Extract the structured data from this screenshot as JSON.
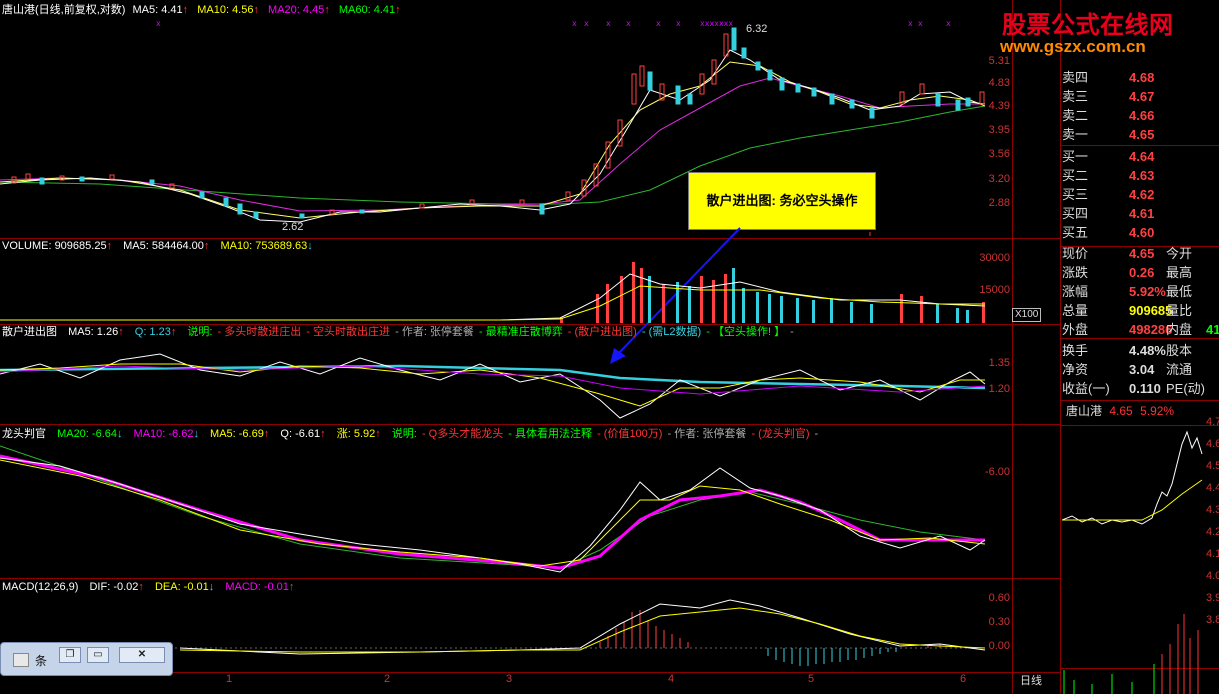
{
  "header": {
    "title": "唐山港(日线,前复权,对数)",
    "ma5": "MA5: 4.41",
    "ma10": "MA10: 4.56",
    "ma20": "MA20: 4.45",
    "ma60": "MA60: 4.41"
  },
  "main_axis": [
    "5.31",
    "4.83",
    "4.39",
    "3.95",
    "3.56",
    "3.20",
    "2.88"
  ],
  "price_notes": {
    "high": "6.32",
    "low": "2.62"
  },
  "volume": {
    "label": "VOLUME: 909685.25",
    "ma5": "MA5: 584464.00",
    "ma10": "MA10: 753689.63",
    "axis": [
      "30000",
      "15000"
    ],
    "unit": "X100"
  },
  "sanhu": {
    "name": "散户进出图",
    "ma5": "MA5: 1.26",
    "q": "Q: 1.23",
    "desc_label": "说明:",
    "d1": "- 多头时散进庄出",
    "d2": "- 空头时散出庄进",
    "d3": "- 作者: 张停套餐",
    "d4": "- 最精准庄散博弈",
    "d5": "- (散户进出图)",
    "d6": "- (需L2数据)",
    "d7": "- 【空头操作! 】",
    "d8": "-",
    "axis": [
      "1.35",
      "1.20"
    ]
  },
  "longtou": {
    "name": "龙头判官",
    "ma20": "MA20: -6.64",
    "ma10": "MA10: -6.62",
    "ma5": "MA5: -6.69",
    "q": "Q: -6.61",
    "zhang": "涨: 5.92",
    "desc_label": "说明:",
    "d1": "- Q多头才能龙头",
    "d2": "- 具体看用法注释",
    "d3": "- (价值100万)",
    "d4": "- 作者: 张停套餐",
    "d5": "- (龙头判官)",
    "d6": "-",
    "axis": [
      "-6.00"
    ]
  },
  "macd": {
    "label": "MACD(12,26,9)",
    "dif": "DIF: -0.02",
    "dea": "DEA: -0.01",
    "macd": "MACD: -0.01",
    "axis": [
      "0.60",
      "0.30",
      "0.00"
    ]
  },
  "x_axis": [
    "1",
    "2",
    "3",
    "4",
    "5",
    "6"
  ],
  "callout": "散户进出图: 务必空头操作",
  "watermark": {
    "line1": "股票公式在线网",
    "line2": "www.gszx.com.cn"
  },
  "orderbook": {
    "asks": [
      {
        "k": "卖四",
        "v": "4.68"
      },
      {
        "k": "卖三",
        "v": "4.67"
      },
      {
        "k": "卖二",
        "v": "4.66"
      },
      {
        "k": "卖一",
        "v": "4.65"
      }
    ],
    "bids": [
      {
        "k": "买一",
        "v": "4.64"
      },
      {
        "k": "买二",
        "v": "4.63"
      },
      {
        "k": "买三",
        "v": "4.62"
      },
      {
        "k": "买四",
        "v": "4.61"
      },
      {
        "k": "买五",
        "v": "4.60"
      }
    ]
  },
  "stats": [
    {
      "k": "现价",
      "v": "4.65",
      "k2": "今开"
    },
    {
      "k": "涨跌",
      "v": "0.26",
      "k2": "最高"
    },
    {
      "k": "涨幅",
      "v": "5.92%",
      "k2": "最低"
    },
    {
      "k": "总量",
      "v": "909685",
      "k2": "量比"
    },
    {
      "k": "外盘",
      "v": "498286",
      "k2": "内盘"
    }
  ],
  "stats2": [
    {
      "k": "换手",
      "v": "4.48%",
      "k2": "股本"
    },
    {
      "k": "净资",
      "v": "3.04",
      "k2": "流通"
    },
    {
      "k": "收益(一)",
      "v": "0.110",
      "k2": "PE(动)"
    }
  ],
  "mini": {
    "name": "唐山港",
    "price": "4.65",
    "pct": "5.92%"
  },
  "mini_axis": [
    "4.7",
    "4.6",
    "4.5",
    "4.4",
    "4.3",
    "4.2",
    "4.1",
    "4.0",
    "3.9",
    "3.8"
  ],
  "period_label": "日线",
  "outer_label": "41",
  "taskbar": {
    "title": "条"
  }
}
